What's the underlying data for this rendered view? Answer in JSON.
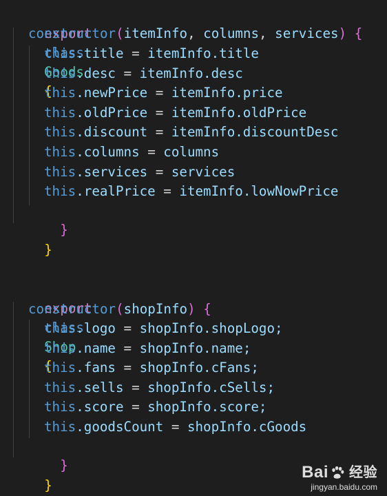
{
  "code": {
    "goods_class": {
      "export_kw": "export",
      "class_kw": "class",
      "name": "Goods",
      "open_brace": "{",
      "ctor_kw": "constructor",
      "ctor_open": "(",
      "p1": "itemInfo",
      "sep1": ", ",
      "p2": "columns",
      "sep2": ", ",
      "p3": "services",
      "ctor_close": ")",
      "ctor_brace": "{",
      "assignments": [
        {
          "this": "this",
          "prop": ".title",
          "eq": " = ",
          "src": "itemInfo.title"
        },
        {
          "this": "this",
          "prop": ".desc",
          "eq": " = ",
          "src": "itemInfo.desc"
        },
        {
          "this": "this",
          "prop": ".newPrice",
          "eq": " = ",
          "src": "itemInfo.price"
        },
        {
          "this": "this",
          "prop": ".oldPrice",
          "eq": " = ",
          "src": "itemInfo.oldPrice"
        },
        {
          "this": "this",
          "prop": ".discount",
          "eq": " = ",
          "src": "itemInfo.discountDesc"
        },
        {
          "this": "this",
          "prop": ".columns",
          "eq": " = ",
          "src": "columns"
        },
        {
          "this": "this",
          "prop": ".services",
          "eq": " = ",
          "src": "services"
        },
        {
          "this": "this",
          "prop": ".realPrice",
          "eq": " = ",
          "src": "itemInfo.lowNowPrice"
        }
      ],
      "ctor_close_brace": "}",
      "close_brace": "}"
    },
    "shop_class": {
      "export_kw": "export",
      "class_kw": "class",
      "name": "Shop",
      "open_brace": "{",
      "ctor_kw": "constructor",
      "ctor_open": "(",
      "p1": "shopInfo",
      "ctor_close": ")",
      "ctor_brace": "{",
      "assignments": [
        {
          "this": "this",
          "prop": ".logo",
          "eq": " = ",
          "src": "shopInfo.shopLogo;"
        },
        {
          "this": "this",
          "prop": ".name",
          "eq": " = ",
          "src": "shopInfo.name;"
        },
        {
          "this": "this",
          "prop": ".fans",
          "eq": " = ",
          "src": "shopInfo.cFans;"
        },
        {
          "this": "this",
          "prop": ".sells",
          "eq": " = ",
          "src": "shopInfo.cSells;"
        },
        {
          "this": "this",
          "prop": ".score",
          "eq": " = ",
          "src": "shopInfo.score;"
        },
        {
          "this": "this",
          "prop": ".goodsCount",
          "eq": " = ",
          "src": "shopInfo.cGoods"
        }
      ],
      "ctor_close_brace": "}",
      "close_brace": "}"
    }
  },
  "watermark": {
    "brand_left": "Bai",
    "brand_right": "百度",
    "sub": "经验",
    "url": "jingyan.baidu.com"
  },
  "colors": {
    "background": "#1e1e1e",
    "keyword": "#569cd6",
    "control_keyword": "#c586c0",
    "class_name": "#4ec9b0",
    "function": "#dcdcaa",
    "variable": "#9cdcfe",
    "brace_level_1": "#ffd700",
    "brace_level_2": "#da70d6"
  }
}
